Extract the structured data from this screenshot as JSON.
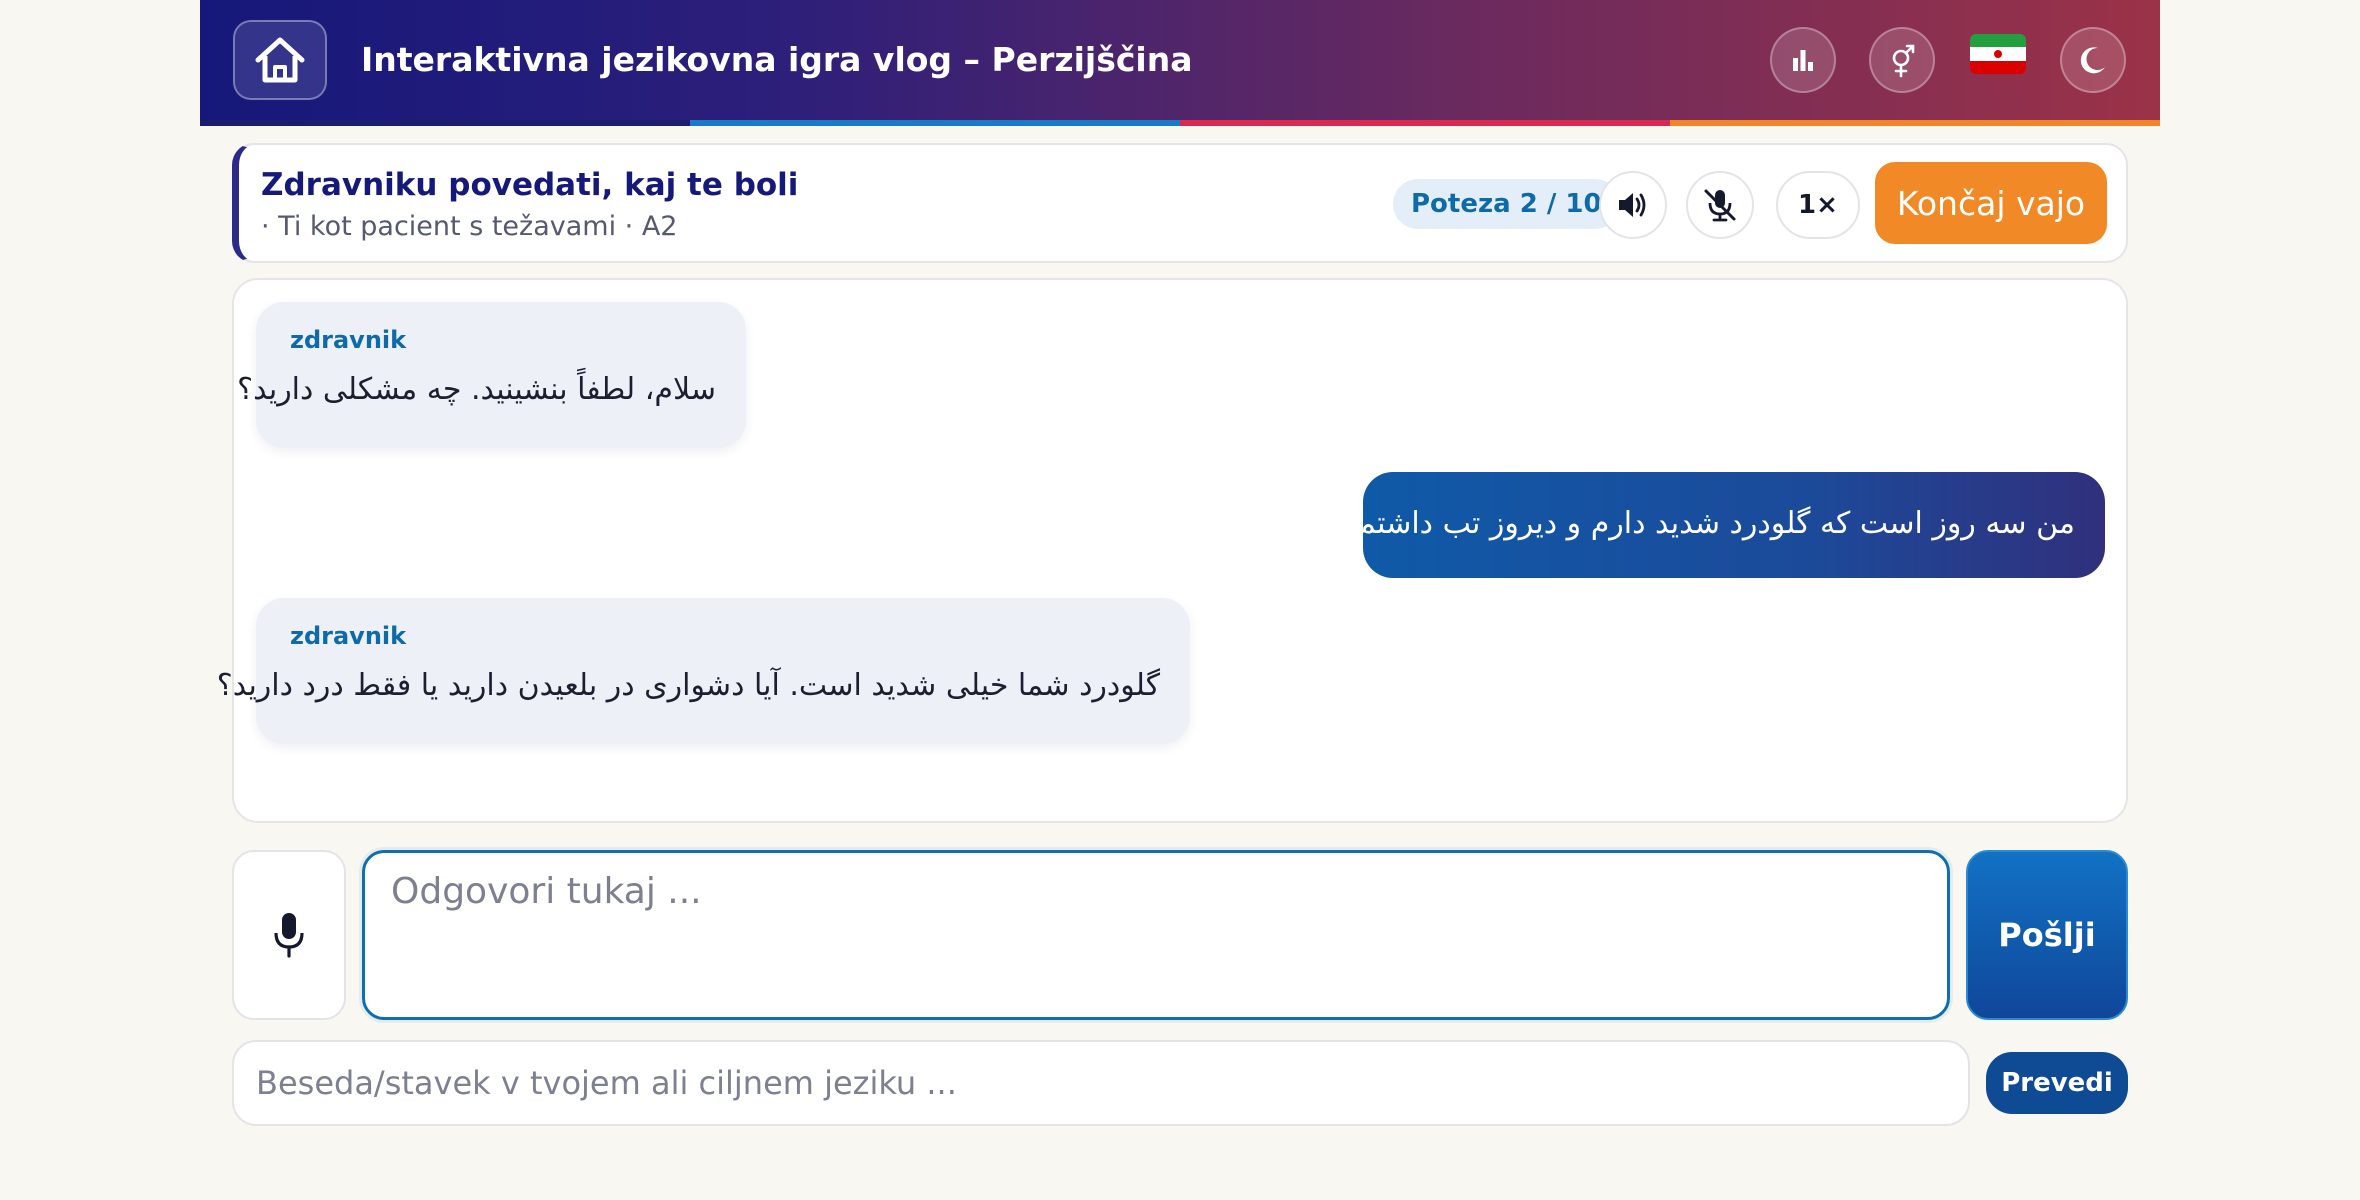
{
  "header": {
    "title": "Interaktivna jezikovna igra vlog – Perzijščina",
    "stripe_colors": [
      "#1a1d6e",
      "#1b7ac8",
      "#d9294e",
      "#f0852b"
    ],
    "icons": {
      "home": "home-icon",
      "stats": "bar-chart-icon",
      "gender": "gender-icon",
      "flag": "iran-flag-icon",
      "theme": "moon-icon"
    }
  },
  "scenario": {
    "title": "Zdravniku povedati, kaj te boli",
    "subtitle": "· Ti kot pacient s težavami · A2",
    "turn": "Poteza 2 / 10",
    "speed": "1×",
    "end_label": "Končaj vajo",
    "icons": {
      "audio": "speaker-icon",
      "mute": "mic-off-icon"
    }
  },
  "chat": {
    "messages": [
      {
        "role": "bot",
        "speaker": "zdravnik",
        "text": "سلام، لطفاً بنشینید. چه مشکلی دارید؟"
      },
      {
        "role": "user",
        "text": "من سه روز است که گلودرد شدید دارم و دیروز تب داشتم."
      },
      {
        "role": "bot",
        "speaker": "zdravnik",
        "text": "گلودرد شما خیلی شدید است. آیا دشواری در بلعیدن دارید یا فقط درد دارید؟"
      }
    ]
  },
  "composer": {
    "mic_icon": "microphone-icon",
    "placeholder": "Odgovori tukaj ...",
    "send_label": "Pošlji"
  },
  "translator": {
    "placeholder": "Beseda/stavek v tvojem ali ciljnem jeziku ...",
    "button_label": "Prevedi"
  },
  "colors": {
    "accent_orange": "#f18a26",
    "accent_blue": "#0e6aa8",
    "navy": "#15197a"
  }
}
